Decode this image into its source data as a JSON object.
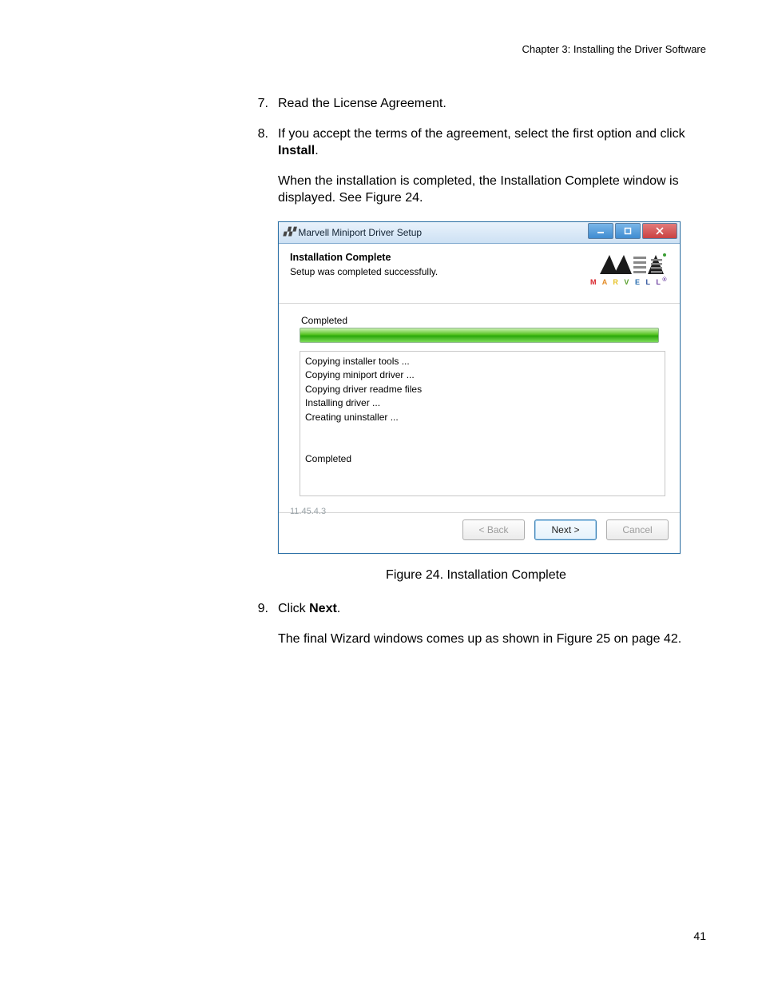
{
  "header": "Chapter 3: Installing the Driver Software",
  "steps": {
    "s7": {
      "num": "7.",
      "text": "Read the License Agreement."
    },
    "s8": {
      "num": "8.",
      "text_pre": "If you accept the terms of the agreement, select the first option and click ",
      "bold": "Install",
      "text_post": "."
    },
    "s8_para": "When the installation is completed, the Installation Complete window is displayed. See Figure 24.",
    "s9": {
      "num": "9.",
      "text_pre": "Click ",
      "bold": "Next",
      "text_post": "."
    },
    "s9_para": "The final Wizard windows comes up as shown in Figure 25 on page 42."
  },
  "figure_caption": "Figure 24. Installation Complete",
  "page_number": "41",
  "dialog": {
    "window_title": "Marvell Miniport Driver Setup",
    "header_title": "Installation Complete",
    "header_sub": "Setup was completed successfully.",
    "logo_text": {
      "m": "M",
      "a": "A",
      "r": "R",
      "v": "V",
      "e": "E",
      "l1": "L",
      "l2": "L",
      "reg": "®"
    },
    "progress_label": "Completed",
    "log": [
      "Copying installer tools ...",
      "Copying miniport driver ...",
      "Copying driver readme files",
      "Installing driver ...",
      "Creating uninstaller ...",
      "",
      "",
      "Completed"
    ],
    "version": "11.45.4.3",
    "buttons": {
      "back": "< Back",
      "next": "Next >",
      "cancel": "Cancel"
    }
  }
}
